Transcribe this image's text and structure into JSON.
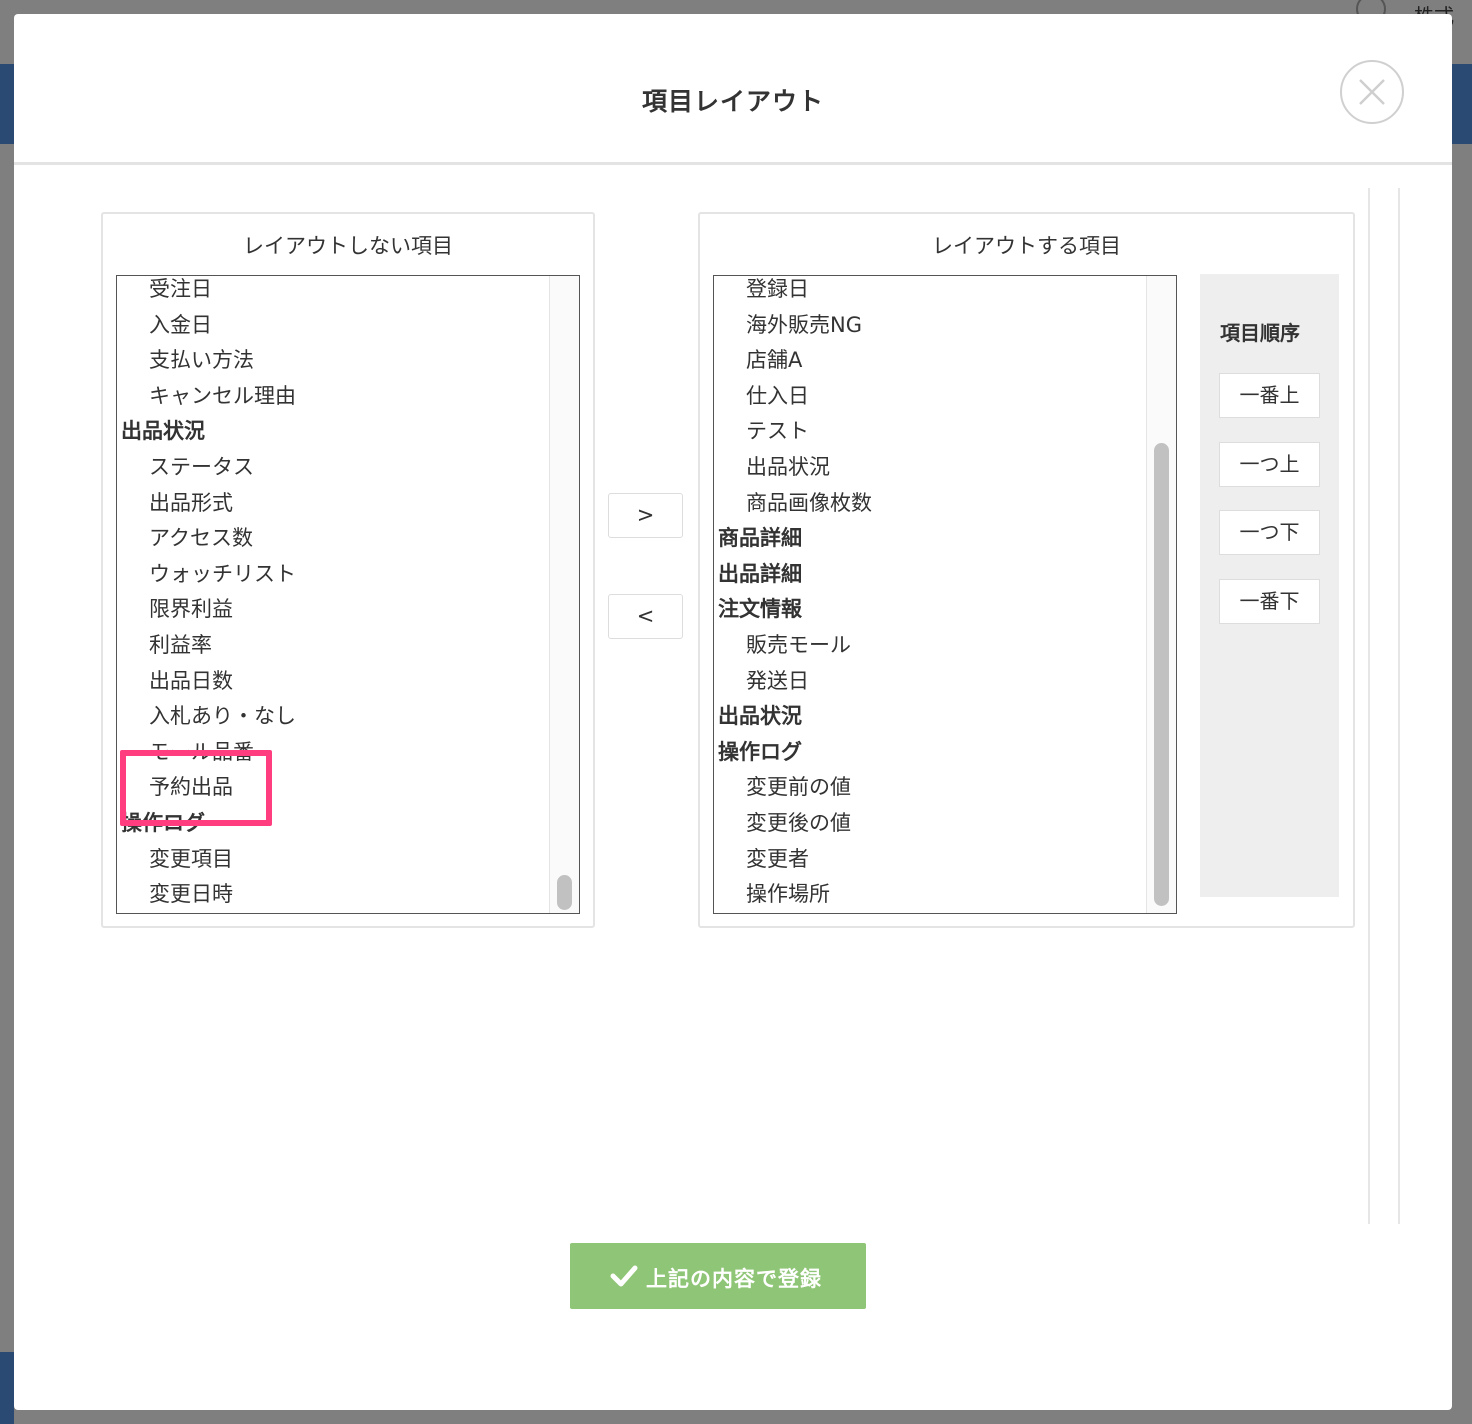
{
  "background": {
    "company_fragment": "株式会"
  },
  "modal": {
    "title": "項目レイアウト",
    "close_icon": "close-icon"
  },
  "left_panel": {
    "title": "レイアウトしない項目",
    "items": [
      {
        "label": "受注日",
        "type": "child"
      },
      {
        "label": "入金日",
        "type": "child"
      },
      {
        "label": "支払い方法",
        "type": "child"
      },
      {
        "label": "キャンセル理由",
        "type": "child"
      },
      {
        "label": "出品状況",
        "type": "group"
      },
      {
        "label": "ステータス",
        "type": "child"
      },
      {
        "label": "出品形式",
        "type": "child"
      },
      {
        "label": "アクセス数",
        "type": "child"
      },
      {
        "label": "ウォッチリスト",
        "type": "child"
      },
      {
        "label": "限界利益",
        "type": "child"
      },
      {
        "label": "利益率",
        "type": "child"
      },
      {
        "label": "出品日数",
        "type": "child"
      },
      {
        "label": "入札あり・なし",
        "type": "child"
      },
      {
        "label": "モール品番",
        "type": "child"
      },
      {
        "label": "予約出品",
        "type": "child"
      },
      {
        "label": "操作ログ",
        "type": "group"
      },
      {
        "label": "変更項目",
        "type": "child"
      },
      {
        "label": "変更日時",
        "type": "child"
      }
    ]
  },
  "transfer": {
    "add_label": ">",
    "remove_label": "<"
  },
  "right_panel": {
    "title": "レイアウトする項目",
    "items": [
      {
        "label": "登録日",
        "type": "child"
      },
      {
        "label": "海外販売NG",
        "type": "child"
      },
      {
        "label": "店舗A",
        "type": "child"
      },
      {
        "label": "仕入日",
        "type": "child"
      },
      {
        "label": "テスト",
        "type": "child"
      },
      {
        "label": "出品状況",
        "type": "child"
      },
      {
        "label": "商品画像枚数",
        "type": "child"
      },
      {
        "label": "商品詳細",
        "type": "group"
      },
      {
        "label": "出品詳細",
        "type": "group"
      },
      {
        "label": "注文情報",
        "type": "group"
      },
      {
        "label": "販売モール",
        "type": "child"
      },
      {
        "label": "発送日",
        "type": "child"
      },
      {
        "label": "出品状況",
        "type": "group"
      },
      {
        "label": "操作ログ",
        "type": "group"
      },
      {
        "label": "変更前の値",
        "type": "child"
      },
      {
        "label": "変更後の値",
        "type": "child"
      },
      {
        "label": "変更者",
        "type": "child"
      },
      {
        "label": "操作場所",
        "type": "child"
      }
    ]
  },
  "order": {
    "title": "項目順序",
    "buttons": [
      "一番上",
      "一つ上",
      "一つ下",
      "一番下"
    ]
  },
  "submit": {
    "label": "上記の内容で登録",
    "icon": "check-icon"
  },
  "colors": {
    "submit_bg": "#8fc576",
    "highlight": "#ff3d7f"
  }
}
